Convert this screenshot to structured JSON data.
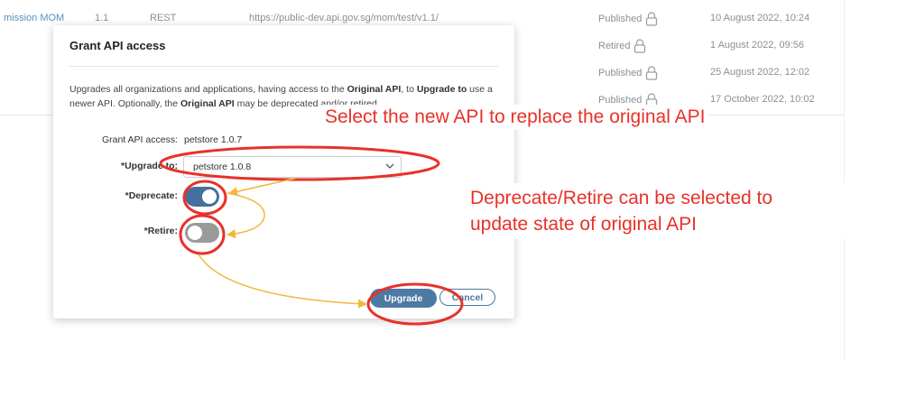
{
  "background_table": {
    "rows": [
      {
        "name": "mission MOM",
        "version": "1.1",
        "type": "REST",
        "url": "https://public-dev.api.gov.sg/mom/test/v1.1/",
        "status": "Published",
        "date": "10 August 2022, 10:24"
      },
      {
        "name": "",
        "version": "",
        "type": "",
        "url": "",
        "status": "Retired",
        "date": "1 August 2022, 09:56"
      },
      {
        "name": "",
        "version": "",
        "type": "",
        "url": "",
        "status": "Published",
        "date": "25 August 2022, 12:02"
      },
      {
        "name": "",
        "version": "",
        "type": "",
        "url": "",
        "status": "Published",
        "date": "17 October 2022, 10:02"
      }
    ]
  },
  "modal": {
    "title": "Grant API access",
    "description": {
      "p1": "Upgrades all organizations and applications, having access to the ",
      "b1": "Original API",
      "p2": ", to ",
      "b2": "Upgrade to",
      "p3": " use a newer API. Optionally, the ",
      "b3": "Original API",
      "p4": " may be deprecated and/or retired."
    },
    "grant_label": "Grant API access:",
    "grant_value": "petstore 1.0.7",
    "upgrade_label": "*Upgrade to:",
    "upgrade_value": "petstore 1.0.8",
    "deprecate_label": "*Deprecate:",
    "deprecate_on": true,
    "retire_label": "*Retire:",
    "retire_on": false,
    "upgrade_button": "Upgrade",
    "cancel_button": "Cancel"
  },
  "annotations": {
    "callout_1": "Select the new API to replace the original API",
    "callout_2_line1": "Deprecate/Retire can be selected to",
    "callout_2_line2": "update state of original API",
    "colors": {
      "red": "#e8312a",
      "yellow": "#f1b73a"
    }
  },
  "icons": [
    "lock-icon",
    "chevron-down-icon"
  ],
  "colors": {
    "primary": "#4c7aa3",
    "toggle_on": "#46709b",
    "toggle_off": "#9a9a9a"
  }
}
